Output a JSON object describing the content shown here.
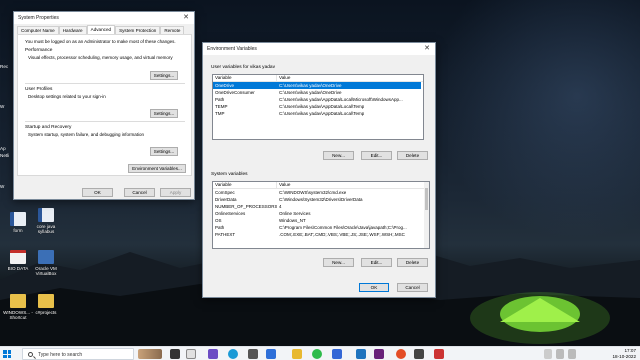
{
  "desktop": {
    "side_labels": [
      "Rec",
      "W",
      "Ap",
      "Netli",
      "W"
    ],
    "icons": [
      {
        "label": "form",
        "icon": "word-document-icon",
        "color": "#e9eef5"
      },
      {
        "label": "core java syllabus",
        "icon": "word-document-icon",
        "color": "#e9eef5"
      },
      {
        "label": "BIO DATA",
        "icon": "pdf-document-icon",
        "color": "#f3f3f3"
      },
      {
        "label": "Oracle VM VirtualBox",
        "icon": "virtualbox-icon",
        "color": "#3b6fb6"
      },
      {
        "label": "WINDOWS... - Shortcut",
        "icon": "folder-shortcut-icon",
        "color": "#e8c04a"
      },
      {
        "label": "c#projects",
        "icon": "folder-icon",
        "color": "#e8c04a"
      }
    ]
  },
  "system_properties": {
    "title": "System Properties",
    "tabs": [
      "Computer Name",
      "Hardware",
      "Advanced",
      "System Protection",
      "Remote"
    ],
    "active_tab": "Advanced",
    "admin_note": "You must be logged on as an Administrator to make most of these changes.",
    "performance": {
      "title": "Performance",
      "desc": "Visual effects, processor scheduling, memory usage, and virtual memory",
      "button": "Settings..."
    },
    "user_profiles": {
      "title": "User Profiles",
      "desc": "Desktop settings related to your sign-in",
      "button": "Settings..."
    },
    "startup": {
      "title": "Startup and Recovery",
      "desc": "System startup, system failure, and debugging information",
      "button": "Settings..."
    },
    "env_button": "Environment Variables...",
    "ok": "OK",
    "cancel": "Cancel",
    "apply": "Apply"
  },
  "env_vars": {
    "title": "Environment Variables",
    "user_label": "User variables for vikas yadav",
    "system_label": "System variables",
    "col_variable": "Variable",
    "col_value": "Value",
    "user_rows": [
      {
        "name": "OneDrive",
        "value": "C:\\Users\\vikas yadav\\OneDrive",
        "selected": true
      },
      {
        "name": "OneDriveConsumer",
        "value": "C:\\Users\\vikas yadav\\OneDrive",
        "selected": false
      },
      {
        "name": "Path",
        "value": "C:\\Users\\vikas yadav\\AppData\\Local\\Microsoft\\WindowsApp...",
        "selected": false
      },
      {
        "name": "TEMP",
        "value": "C:\\Users\\vikas yadav\\AppData\\Local\\Temp",
        "selected": false
      },
      {
        "name": "TMP",
        "value": "C:\\Users\\vikas yadav\\AppData\\Local\\Temp",
        "selected": false
      }
    ],
    "system_rows": [
      {
        "name": "ComSpec",
        "value": "C:\\WINDOWS\\system32\\cmd.exe"
      },
      {
        "name": "DriverData",
        "value": "C:\\Windows\\System32\\Drivers\\DriverData"
      },
      {
        "name": "NUMBER_OF_PROCESSORS",
        "value": "4"
      },
      {
        "name": "OnlineServices",
        "value": "Online Services"
      },
      {
        "name": "OS",
        "value": "Windows_NT"
      },
      {
        "name": "Path",
        "value": "C:\\Program Files\\Common Files\\Oracle\\Java\\javapath;C:\\Prog..."
      },
      {
        "name": "PATHEXT",
        "value": ".COM;.EXE;.BAT;.CMD;.VBS;.VBE;.JS;.JSE;.WSF;.WSH;.MSC"
      }
    ],
    "new": "New...",
    "edit": "Edit...",
    "delete": "Delete",
    "ok": "OK",
    "cancel": "Cancel"
  },
  "taskbar": {
    "search_placeholder": "Type here to search",
    "time": "17:07",
    "date": "18-10-2022"
  },
  "colors": {
    "selection": "#0078d7",
    "accent": "#0078d7"
  }
}
